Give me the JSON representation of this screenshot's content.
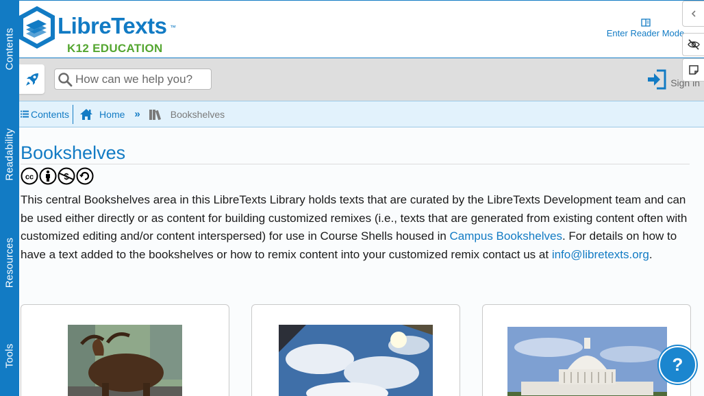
{
  "sidebar": {
    "tabs": [
      {
        "label": "Contents"
      },
      {
        "label": "Readability"
      },
      {
        "label": "Resources"
      },
      {
        "label": "Tools"
      }
    ]
  },
  "header": {
    "logo_word": "LibreTexts",
    "logo_tm": "™",
    "logo_sub": "K12 EDUCATION",
    "reader_mode_label": "Enter Reader Mode",
    "brand_color": "#127bc4",
    "accent_green": "#54a630"
  },
  "right_tools": [
    {
      "icon": "chevron-left-icon"
    },
    {
      "icon": "eye-slash-icon"
    },
    {
      "icon": "sticky-note-icon"
    }
  ],
  "navbar": {
    "search": {
      "placeholder": "How can we help you?",
      "value": ""
    },
    "signin_label": "Sign in",
    "rocket_icon": "rocket-icon"
  },
  "breadcrumb": {
    "contents_label": "Contents",
    "home_label": "Home",
    "separator": "»",
    "current_label": "Bookshelves"
  },
  "main": {
    "title": "Bookshelves",
    "license_icons": [
      "cc-icon",
      "by-icon",
      "nc-icon",
      "sa-icon"
    ],
    "intro_before_link": "This central Bookshelves area in this LibreTexts Library holds texts that are curated by the LibreTexts Development team and can be used either directly or as content for building customized remixes (i.e., texts that are generated from existing content often with customized editing and/or content interspersed) for use in Course Shells housed in ",
    "intro_link1": "Campus Bookshelves",
    "intro_middle": ". For details on how to have a text added to the bookshelves or how to remix content into your customized remix contact us at ",
    "intro_link2": "info@libretexts.org",
    "intro_end": "."
  },
  "cards": [
    {
      "image": "bull-statue-photo"
    },
    {
      "image": "sky-reflection-photo"
    },
    {
      "image": "capitol-building-photo"
    }
  ],
  "help_label": "?"
}
